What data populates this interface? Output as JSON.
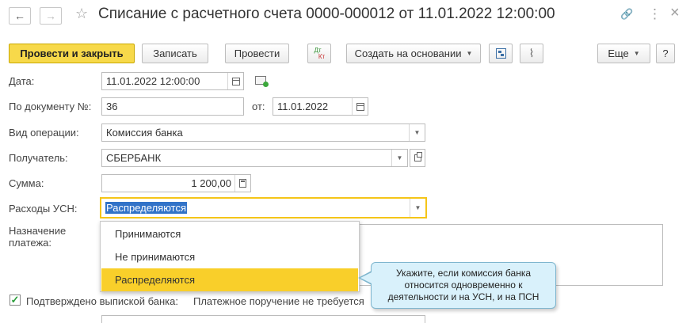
{
  "window": {
    "title": "Списание с расчетного счета 0000-000012 от 11.01.2022 12:00:00",
    "back_icon": "←",
    "forward_icon": "→",
    "star_icon": "☆",
    "link_icon": "🔗",
    "more_icon": "⋮",
    "close_icon": "×"
  },
  "toolbar": {
    "post_close": "Провести и закрыть",
    "save": "Записать",
    "post": "Провести",
    "dt_kt_top": "Дт",
    "dt_kt_bottom": "Кт",
    "create_based": "Создать на основании",
    "more": "Еще",
    "help": "?"
  },
  "form": {
    "date_label": "Дата:",
    "date_value": "11.01.2022 12:00:00",
    "doc_number_label": "По документу №:",
    "doc_number_value": "36",
    "from_label": "от:",
    "from_value": "11.01.2022",
    "operation_label": "Вид операции:",
    "operation_value": "Комиссия банка",
    "recipient_label": "Получатель:",
    "recipient_value": "СБЕРБАНК",
    "amount_label": "Сумма:",
    "amount_value": "1 200,00",
    "usn_label": "Расходы УСН:",
    "usn_value": "Распределяются",
    "purpose_label_1": "Назначение",
    "purpose_label_2": "платежа:",
    "confirmed_label": "Подтверждено выпиской банка:",
    "payment_order_text": "Платежное поручение не требуется"
  },
  "dropdown": {
    "options": [
      "Принимаются",
      "Не принимаются",
      "Распределяются"
    ],
    "selected": "Распределяются"
  },
  "tooltip": {
    "line1": "Укажите, если комиссия банка",
    "line2": "относится одновременно к",
    "line3": "деятельности и на УСН, и на ПСН"
  },
  "colors": {
    "accent_yellow": "#f7d94a",
    "selection_blue": "#3273c8",
    "tooltip_bg": "#d9f1fb"
  }
}
